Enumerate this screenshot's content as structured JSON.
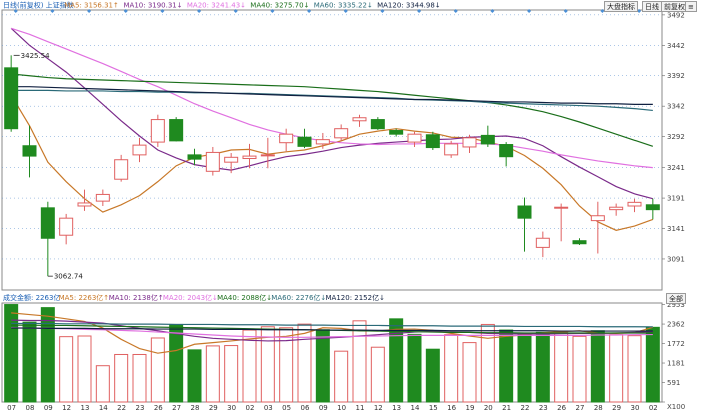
{
  "top_buttons": [
    "大盘指标",
    "日线",
    "前复权",
    "≡"
  ],
  "volume_unit_button": "全部",
  "colors": {
    "up": "#e06060",
    "down": "#1f8a1f",
    "ma5": "#c87828",
    "ma10": "#7a2a8a",
    "ma20": "#e070e0",
    "ma40": "#1a6e1a",
    "ma60": "#2a6a78",
    "ma120": "#102040",
    "grid": "#5a8fcf"
  },
  "chart_data": {
    "type": "candlestick",
    "x": [
      "07",
      "08",
      "09",
      "12",
      "13",
      "14",
      "22",
      "23",
      "26",
      "27",
      "28",
      "29",
      "30",
      "02",
      "03",
      "05",
      "06",
      "09",
      "10",
      "11",
      "12",
      "13",
      "14",
      "15",
      "16",
      "19",
      "20",
      "21",
      "22",
      "23",
      "26",
      "27",
      "28",
      "29",
      "30",
      "02"
    ],
    "tick_labels": [
      "07",
      "08",
      "09",
      "12",
      "13",
      "14",
      "22",
      "23",
      "26",
      "27",
      "28",
      "29",
      "30",
      "02",
      "03",
      "05",
      "06",
      "09",
      "10",
      "11",
      "12",
      "13",
      "14",
      "15",
      "16",
      "19",
      "20",
      "21",
      "22",
      "23",
      "26",
      "27",
      "28",
      "29",
      "30",
      "02"
    ],
    "price_axis": {
      "ticks": [
        3091,
        3141,
        3191,
        3241,
        3292,
        3342,
        3392,
        3442,
        3492
      ],
      "ylim": [
        3040,
        3500
      ]
    },
    "volume_axis": {
      "ticks": [
        0,
        591,
        1181,
        1772,
        2362,
        2953
      ],
      "label_bottom": "X100",
      "ylim": [
        0,
        3000
      ]
    },
    "price_labels": {
      "high": "3425.54",
      "low": "3062.74"
    },
    "price_legend": {
      "symbol": "日线(前复权) 上证指数",
      "items": [
        {
          "label": "MA5: 3156.31↑",
          "color_key": "ma5"
        },
        {
          "label": "MA10: 3190.31↓",
          "color_key": "ma10"
        },
        {
          "label": "MA20: 3241.43↓",
          "color_key": "ma20"
        },
        {
          "label": "MA40: 3275.70↓",
          "color_key": "ma40"
        },
        {
          "label": "MA60: 3335.22↓",
          "color_key": "ma60"
        },
        {
          "label": "MA120: 3344.98↓",
          "color_key": "ma120"
        }
      ]
    },
    "volume_legend": {
      "title": "成交金额: 2263亿",
      "items": [
        {
          "label": "MA5: 2263亿↑",
          "color_key": "ma5"
        },
        {
          "label": "MA10: 2138亿↑",
          "color_key": "ma10"
        },
        {
          "label": "MA20: 2043亿↓",
          "color_key": "ma20"
        },
        {
          "label": "MA40: 2088亿↓",
          "color_key": "ma40"
        },
        {
          "label": "MA60: 2276亿↓",
          "color_key": "ma60"
        },
        {
          "label": "MA120: 2152亿↓",
          "color_key": "ma120"
        }
      ]
    },
    "candles": [
      {
        "o": 3405,
        "h": 3425.54,
        "l": 3300,
        "c": 3305
      },
      {
        "o": 3277,
        "h": 3310,
        "l": 3225,
        "c": 3260
      },
      {
        "o": 3175,
        "h": 3185,
        "l": 3062.74,
        "c": 3125
      },
      {
        "o": 3130,
        "h": 3165,
        "l": 3115,
        "c": 3158
      },
      {
        "o": 3178,
        "h": 3205,
        "l": 3170,
        "c": 3183
      },
      {
        "o": 3186,
        "h": 3205,
        "l": 3178,
        "c": 3197
      },
      {
        "o": 3222,
        "h": 3262,
        "l": 3218,
        "c": 3254
      },
      {
        "o": 3262,
        "h": 3290,
        "l": 3250,
        "c": 3278
      },
      {
        "o": 3283,
        "h": 3328,
        "l": 3275,
        "c": 3320
      },
      {
        "o": 3320,
        "h": 3324,
        "l": 3284,
        "c": 3285
      },
      {
        "o": 3262,
        "h": 3272,
        "l": 3245,
        "c": 3255
      },
      {
        "o": 3235,
        "h": 3275,
        "l": 3228,
        "c": 3266
      },
      {
        "o": 3250,
        "h": 3265,
        "l": 3232,
        "c": 3258
      },
      {
        "o": 3256,
        "h": 3280,
        "l": 3240,
        "c": 3260
      },
      {
        "o": 3262,
        "h": 3290,
        "l": 3240,
        "c": 3262
      },
      {
        "o": 3282,
        "h": 3305,
        "l": 3268,
        "c": 3296
      },
      {
        "o": 3291,
        "h": 3305,
        "l": 3273,
        "c": 3276
      },
      {
        "o": 3280,
        "h": 3298,
        "l": 3272,
        "c": 3287
      },
      {
        "o": 3290,
        "h": 3312,
        "l": 3285,
        "c": 3305
      },
      {
        "o": 3318,
        "h": 3328,
        "l": 3308,
        "c": 3323
      },
      {
        "o": 3320,
        "h": 3324,
        "l": 3303,
        "c": 3305
      },
      {
        "o": 3302,
        "h": 3305,
        "l": 3292,
        "c": 3296
      },
      {
        "o": 3283,
        "h": 3300,
        "l": 3275,
        "c": 3296
      },
      {
        "o": 3295,
        "h": 3300,
        "l": 3270,
        "c": 3274
      },
      {
        "o": 3262,
        "h": 3285,
        "l": 3257,
        "c": 3280
      },
      {
        "o": 3275,
        "h": 3295,
        "l": 3265,
        "c": 3290
      },
      {
        "o": 3294,
        "h": 3310,
        "l": 3275,
        "c": 3280
      },
      {
        "o": 3279,
        "h": 3283,
        "l": 3243,
        "c": 3259
      },
      {
        "o": 3178,
        "h": 3192,
        "l": 3103,
        "c": 3158
      },
      {
        "o": 3110,
        "h": 3136,
        "l": 3094,
        "c": 3125
      },
      {
        "o": 3176,
        "h": 3182,
        "l": 3120,
        "c": 3176
      },
      {
        "o": 3121,
        "h": 3125,
        "l": 3114,
        "c": 3116
      },
      {
        "o": 3154,
        "h": 3185,
        "l": 3100,
        "c": 3162
      },
      {
        "o": 3172,
        "h": 3182,
        "l": 3162,
        "c": 3176
      },
      {
        "o": 3178,
        "h": 3190,
        "l": 3168,
        "c": 3184
      },
      {
        "o": 3180,
        "h": 3190,
        "l": 3156,
        "c": 3172
      }
    ],
    "volumes": [
      2953,
      2420,
      2860,
      1980,
      2000,
      1100,
      1440,
      1440,
      1940,
      2350,
      1580,
      1700,
      1710,
      2180,
      2280,
      2250,
      2360,
      2190,
      1540,
      2460,
      1660,
      2520,
      2050,
      1600,
      2040,
      1800,
      2350,
      2180,
      2060,
      2110,
      2110,
      1990,
      2160,
      2040,
      2010,
      2263
    ],
    "volume_up": [
      false,
      false,
      false,
      true,
      true,
      true,
      true,
      true,
      true,
      false,
      false,
      true,
      true,
      true,
      true,
      true,
      true,
      false,
      true,
      true,
      true,
      false,
      false,
      false,
      true,
      true,
      true,
      false,
      false,
      false,
      true,
      true,
      false,
      true,
      true,
      false
    ],
    "ma_lines": {
      "ma5": [
        3360,
        3310,
        3250,
        3218,
        3190,
        3168,
        3180,
        3195,
        3218,
        3244,
        3258,
        3263,
        3270,
        3271,
        3263,
        3267,
        3270,
        3277,
        3285,
        3296,
        3301,
        3305,
        3301,
        3298,
        3291,
        3290,
        3283,
        3276,
        3261,
        3240,
        3213,
        3178,
        3152,
        3138,
        3145,
        3156
      ],
      "ma10": [
        3470,
        3442,
        3420,
        3398,
        3372,
        3345,
        3318,
        3293,
        3270,
        3257,
        3246,
        3241,
        3237,
        3244,
        3252,
        3259,
        3263,
        3268,
        3274,
        3278,
        3281,
        3283,
        3285,
        3287,
        3288,
        3291,
        3292,
        3293,
        3289,
        3277,
        3259,
        3242,
        3226,
        3210,
        3198,
        3190
      ],
      "ma20": [
        3470,
        3460,
        3448,
        3436,
        3424,
        3412,
        3399,
        3386,
        3374,
        3360,
        3346,
        3334,
        3323,
        3312,
        3303,
        3296,
        3290,
        3285,
        3282,
        3280,
        3279,
        3280,
        3280,
        3281,
        3281,
        3281,
        3280,
        3278,
        3273,
        3268,
        3262,
        3257,
        3252,
        3248,
        3244,
        3241
      ],
      "ma40": [
        3395,
        3392,
        3389,
        3387,
        3386,
        3385,
        3384,
        3383,
        3382,
        3381,
        3380,
        3379,
        3378,
        3377,
        3376,
        3375,
        3374,
        3372,
        3370,
        3368,
        3366,
        3363,
        3360,
        3357,
        3354,
        3351,
        3348,
        3344,
        3339,
        3333,
        3325,
        3316,
        3306,
        3296,
        3286,
        3276
      ],
      "ma60": [
        3368,
        3368,
        3368,
        3367,
        3367,
        3367,
        3366,
        3366,
        3365,
        3365,
        3364,
        3364,
        3363,
        3363,
        3362,
        3361,
        3360,
        3359,
        3358,
        3357,
        3356,
        3355,
        3353,
        3352,
        3351,
        3350,
        3348,
        3347,
        3346,
        3345,
        3344,
        3343,
        3342,
        3340,
        3338,
        3335
      ],
      "ma120": [
        3374,
        3374,
        3373,
        3372,
        3371,
        3370,
        3369,
        3368,
        3367,
        3366,
        3365,
        3364,
        3363,
        3362,
        3361,
        3360,
        3359,
        3358,
        3357,
        3356,
        3355,
        3354,
        3353,
        3353,
        3352,
        3351,
        3350,
        3349,
        3349,
        3348,
        3347,
        3347,
        3346,
        3346,
        3345,
        3345
      ]
    },
    "vol_ma_lines": {
      "ma5": [
        2700,
        2650,
        2600,
        2520,
        2440,
        2240,
        1900,
        1620,
        1480,
        1560,
        1750,
        1800,
        1850,
        1910,
        1960,
        1990,
        2080,
        2250,
        2230,
        2160,
        2150,
        2200,
        2210,
        2170,
        2080,
        2000,
        1930,
        1990,
        2030,
        2100,
        2130,
        2160,
        2090,
        2080,
        2100,
        2263
      ],
      "ma10": [
        2480,
        2470,
        2470,
        2450,
        2420,
        2390,
        2310,
        2230,
        2160,
        2070,
        1990,
        1930,
        1900,
        1870,
        1850,
        1860,
        1900,
        1930,
        1960,
        2000,
        2040,
        2080,
        2120,
        2140,
        2120,
        2110,
        2080,
        2070,
        2060,
        2060,
        2070,
        2080,
        2080,
        2090,
        2110,
        2138
      ],
      "ma20": [
        2250,
        2240,
        2230,
        2220,
        2200,
        2190,
        2170,
        2150,
        2120,
        2090,
        2060,
        2030,
        2000,
        1980,
        1970,
        1960,
        1960,
        1970,
        1980,
        1990,
        2000,
        2010,
        2020,
        2020,
        2020,
        2020,
        2020,
        2020,
        2020,
        2020,
        2020,
        2020,
        2030,
        2030,
        2040,
        2043
      ],
      "ma40": [
        2330,
        2330,
        2320,
        2320,
        2310,
        2300,
        2290,
        2280,
        2270,
        2260,
        2250,
        2240,
        2230,
        2220,
        2210,
        2200,
        2190,
        2180,
        2170,
        2160,
        2150,
        2140,
        2130,
        2120,
        2110,
        2110,
        2100,
        2100,
        2090,
        2090,
        2090,
        2090,
        2090,
        2090,
        2090,
        2088
      ],
      "ma60": [
        2380,
        2380,
        2380,
        2370,
        2370,
        2370,
        2360,
        2360,
        2360,
        2350,
        2350,
        2350,
        2340,
        2340,
        2340,
        2330,
        2330,
        2330,
        2320,
        2320,
        2320,
        2310,
        2310,
        2310,
        2300,
        2300,
        2300,
        2300,
        2290,
        2290,
        2290,
        2290,
        2280,
        2280,
        2280,
        2276
      ],
      "ma120": [
        2240,
        2240,
        2230,
        2230,
        2230,
        2220,
        2220,
        2220,
        2210,
        2210,
        2210,
        2200,
        2200,
        2200,
        2190,
        2190,
        2190,
        2180,
        2180,
        2180,
        2170,
        2170,
        2170,
        2170,
        2160,
        2160,
        2160,
        2160,
        2160,
        2160,
        2150,
        2150,
        2150,
        2150,
        2150,
        2152
      ]
    }
  }
}
